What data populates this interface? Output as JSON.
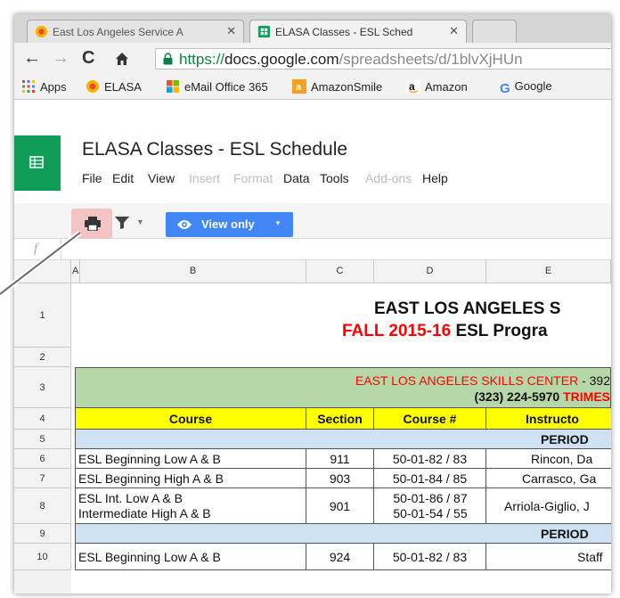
{
  "tabs": [
    {
      "title": "East Los Angeles Service A",
      "active": false
    },
    {
      "title": "ELASA Classes - ESL Sched",
      "active": true
    }
  ],
  "address": {
    "scheme": "https://",
    "host": "docs.google.com",
    "path": "/spreadsheets/d/1blvXjHUn"
  },
  "bookmarks": [
    "Apps",
    "ELASA",
    "eMail Office 365",
    "AmazonSmile",
    "Amazon",
    "Google"
  ],
  "doc_title": "ELASA Classes - ESL Schedule",
  "menus": [
    {
      "label": "File",
      "disabled": false
    },
    {
      "label": "Edit",
      "disabled": false
    },
    {
      "label": "View",
      "disabled": false
    },
    {
      "label": "Insert",
      "disabled": true
    },
    {
      "label": "Format",
      "disabled": true
    },
    {
      "label": "Data",
      "disabled": false
    },
    {
      "label": "Tools",
      "disabled": false
    },
    {
      "label": "Add-ons",
      "disabled": true
    },
    {
      "label": "Help",
      "disabled": false
    }
  ],
  "toolbar": {
    "view_only": "View only"
  },
  "fx": "f",
  "columns": [
    "A",
    "B",
    "C",
    "D",
    "E"
  ],
  "rows": [
    "1",
    "2",
    "3",
    "4",
    "5",
    "6",
    "7",
    "8",
    "9",
    "10"
  ],
  "sheet": {
    "title1": "EAST LOS ANGELES S",
    "title2_red": "FALL 2015-16",
    "title2_black": "ESL Progra",
    "banner_red": "EAST LOS ANGELES SKILLS CENTER",
    "banner_black": " - 392",
    "phone": "(323) 224-5970",
    "trimes": "TRIMES",
    "headers": [
      "Course",
      "Section",
      "Course #",
      "Instructo"
    ],
    "period_a": "PERIOD",
    "period_b": "PERIOD",
    "data": [
      {
        "course": "ESL Beginning Low A & B",
        "course2": "",
        "section": "911",
        "num": "50-01-82 / 83",
        "num2": "",
        "instructor": "Rincon, Da"
      },
      {
        "course": "ESL Beginning High A & B",
        "course2": "",
        "section": "903",
        "num": "50-01-84 / 85",
        "num2": "",
        "instructor": "Carrasco, Ga"
      },
      {
        "course": "ESL Int. Low A & B",
        "course2": "Intermediate High A & B",
        "section": "901",
        "num": "50-01-86 / 87",
        "num2": "50-01-54 / 55",
        "instructor": "Arriola-Giglio, J"
      },
      {
        "course": "ESL Beginning Low A & B",
        "course2": "",
        "section": "924",
        "num": "50-01-82 / 83",
        "num2": "",
        "instructor": "Staff"
      }
    ]
  },
  "colors": {
    "sheets_green": "#0f9d58",
    "view_only_blue": "#4285f4",
    "banner_green": "#b6d7a8",
    "header_yellow": "#ffff00",
    "period_blue": "#cfe2f3",
    "red": "#ff0000"
  }
}
